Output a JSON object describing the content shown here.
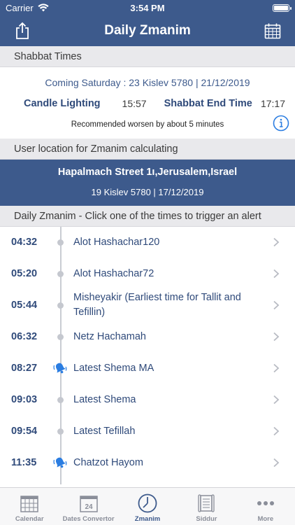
{
  "status_bar": {
    "carrier": "Carrier",
    "time": "3:54 PM"
  },
  "navbar": {
    "title": "Daily Zmanim"
  },
  "shabbat": {
    "section_title": "Shabbat Times",
    "coming": "Coming Saturday : 23 Kislev 5780 | 21/12/2019",
    "candle_label": "Candle Lighting",
    "candle_time": "15:57",
    "end_label": "Shabbat End Time",
    "end_time": "17:17",
    "note": "Recommended worsen by about 5 minutes"
  },
  "location": {
    "section_title": "User location for Zmanim calculating",
    "street": "Hapalmach Street 1ı,Jerusalem,Israel",
    "date": "19 Kislev 5780 | 17/12/2019"
  },
  "zmanim": {
    "section_title": "Daily Zmanim - Click one of the times to trigger an alert",
    "items": [
      {
        "time": "04:32",
        "name": "Alot Hashachar120",
        "alert": false
      },
      {
        "time": "05:20",
        "name": "Alot Hashachar72",
        "alert": false
      },
      {
        "time": "05:44",
        "name": "Misheyakir (Earliest time for Tallit and Tefillin)",
        "alert": false
      },
      {
        "time": "06:32",
        "name": "Netz Hachamah",
        "alert": false
      },
      {
        "time": "08:27",
        "name": "Latest Shema MA",
        "alert": true
      },
      {
        "time": "09:03",
        "name": "Latest Shema",
        "alert": false
      },
      {
        "time": "09:54",
        "name": "Latest Tefillah",
        "alert": false
      },
      {
        "time": "11:35",
        "name": "Chatzot Hayom",
        "alert": true
      }
    ]
  },
  "tabbar": {
    "tabs": [
      {
        "label": "Calendar",
        "icon": "calendar-grid-icon"
      },
      {
        "label": "Dates Convertor",
        "icon": "calendar-date-icon",
        "date_number": "24"
      },
      {
        "label": "Zmanim",
        "icon": "clock-icon",
        "active": true
      },
      {
        "label": "Siddur",
        "icon": "scroll-icon"
      },
      {
        "label": "More",
        "icon": "more-dots-icon"
      }
    ]
  },
  "colors": {
    "primary": "#3d5a8c",
    "accent": "#2b7de1",
    "section_bg": "#e9e9ec"
  }
}
